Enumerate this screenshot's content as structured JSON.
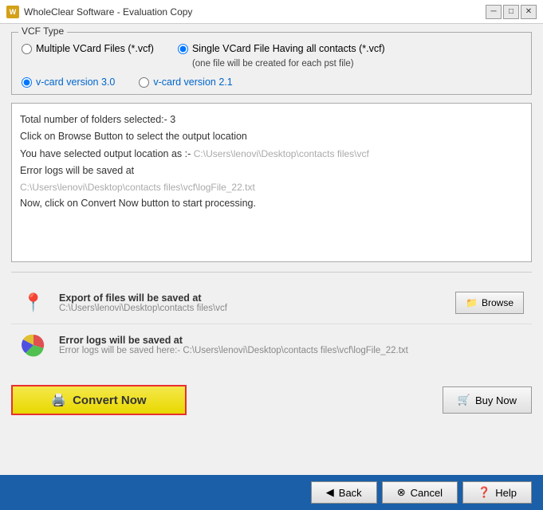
{
  "titleBar": {
    "title": "WholeClear Software - Evaluation Copy",
    "minimizeLabel": "─",
    "maximizeLabel": "□",
    "closeLabel": "✕"
  },
  "vcfType": {
    "legend": "VCF Type",
    "option1": {
      "label": "Multiple VCard Files (*.vcf)",
      "checked": false
    },
    "option2": {
      "line1": "Single VCard File Having all contacts (*.vcf)",
      "line2": "(one file will be created for each pst file)",
      "checked": true
    },
    "version1": {
      "label": "v-card version 3.0",
      "checked": true
    },
    "version2": {
      "label": "v-card version 2.1",
      "checked": false
    }
  },
  "logArea": {
    "line1": "Total number of folders selected:- 3",
    "line2": "Click on Browse Button to select the output location",
    "line3": "You have selected output location as :-",
    "line3path": "C:\\Users\\lenovi\\Desktop\\contacts files\\vcf",
    "line4": "Error logs will be saved at",
    "line4path": "C:\\Users\\lenovi\\Desktop\\contacts files\\vcf\\logFile_22.txt",
    "line5": "Now, click on Convert Now button to start processing."
  },
  "exportRow": {
    "label": "Export of files will be saved at",
    "path": "C:\\Users\\lenovi\\Desktop\\contacts files\\vcf",
    "browseLabel": "Browse"
  },
  "errorRow": {
    "label": "Error logs will be saved at",
    "pathLabel": "Error logs will be saved here:-",
    "path": "C:\\Users\\lenovi\\Desktop\\contacts files\\vcf\\logFile_22.txt"
  },
  "convertBtn": {
    "label": "Convert Now"
  },
  "buyBtn": {
    "label": "Buy Now"
  },
  "bottomBar": {
    "backLabel": "Back",
    "cancelLabel": "Cancel",
    "helpLabel": "Help"
  }
}
